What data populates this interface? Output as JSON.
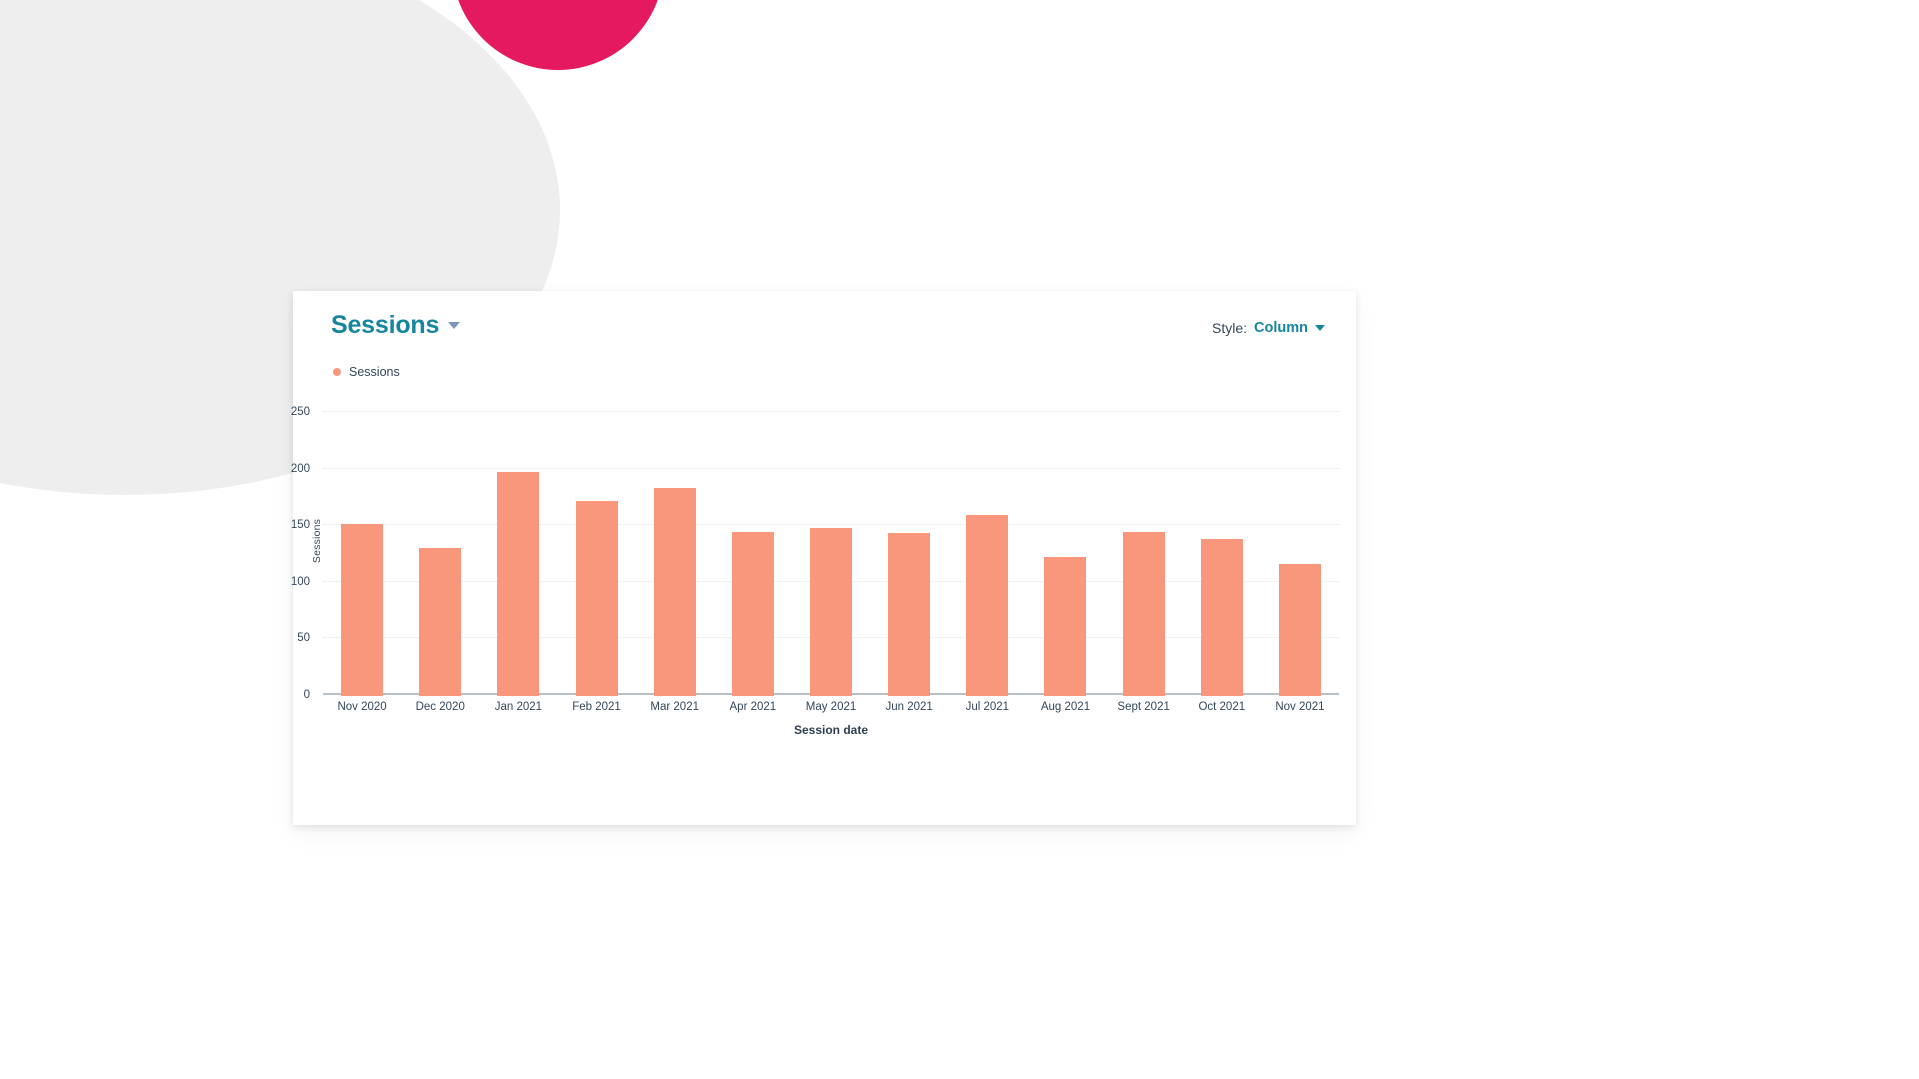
{
  "background": {
    "page_color": "#ffffff",
    "gray_blob_color": "#eeeeee",
    "pink_circle_color": "#e5195f"
  },
  "card": {
    "title": "Sessions",
    "title_color": "#16859e",
    "title_caret_icon": "chevron-down-icon",
    "style_control": {
      "label": "Style:",
      "value": "Column",
      "caret_icon": "chevron-down-icon"
    }
  },
  "legend": {
    "marker_icon": "dot-icon",
    "marker_color": "#f8977c",
    "label": "Sessions"
  },
  "chart_data": {
    "type": "bar",
    "title": "Sessions",
    "xlabel": "Session date",
    "ylabel": "Sessions",
    "ylim": [
      0,
      250
    ],
    "yticks": [
      250,
      200,
      150,
      100,
      50,
      0
    ],
    "grid": true,
    "legend_position": "top-left",
    "bar_color": "#f8977c",
    "categories": [
      "Nov 2020",
      "Dec 2020",
      "Jan 2021",
      "Feb 2021",
      "Mar 2021",
      "Apr 2021",
      "May 2021",
      "Jun 2021",
      "Jul 2021",
      "Aug 2021",
      "Sept 2021",
      "Oct 2021",
      "Nov 2021"
    ],
    "series": [
      {
        "name": "Sessions",
        "values": [
          152,
          131,
          198,
          172,
          184,
          145,
          148,
          144,
          160,
          123,
          145,
          139,
          117
        ]
      }
    ]
  }
}
